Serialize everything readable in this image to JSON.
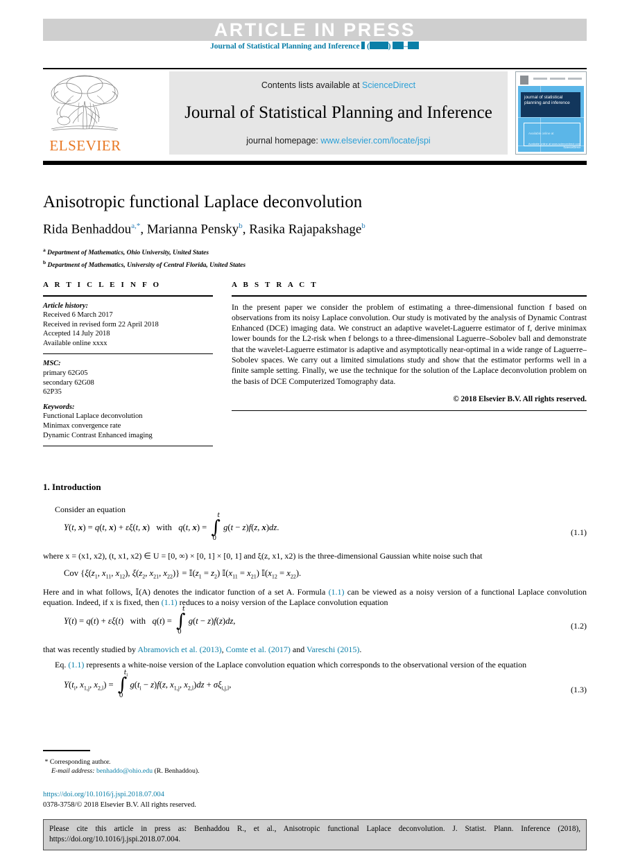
{
  "banner": {
    "label": "ARTICLE  IN  PRESS",
    "running_head_prefix": "Journal of Statistical Planning and Inference"
  },
  "masthead": {
    "contents_prefix": "Contents lists available at",
    "sciencedirect": "ScienceDirect",
    "journal_title": "Journal of Statistical Planning and Inference",
    "homepage_prefix": "journal homepage:",
    "homepage_url": "www.elsevier.com/locate/jspi",
    "publisher": "ELSEVIER",
    "cover": {
      "band_text": "journal of statistical planning and inference",
      "issn_note": "Available online at",
      "footer_line1": "Available online at www.sciencedirect.com",
      "footer_line2": "ScienceDirect"
    }
  },
  "article": {
    "title": "Anisotropic functional Laplace deconvolution",
    "authors": [
      {
        "name": "Rida Benhaddou",
        "marks": "a,*"
      },
      {
        "name": "Marianna Pensky",
        "marks": "b"
      },
      {
        "name": "Rasika Rajapakshage",
        "marks": "b"
      }
    ],
    "authors_plain": "Rida Benhaddou a,*, Marianna Pensky b, Rasika Rajapakshage b",
    "affiliations": [
      {
        "mark": "a",
        "text": "Department of Mathematics, Ohio University, United States"
      },
      {
        "mark": "b",
        "text": "Department of Mathematics, University of Central Florida, United States"
      }
    ]
  },
  "info": {
    "heading": "A R T I C L E   I N F O",
    "history_label": "Article history:",
    "history": [
      "Received 6 March 2017",
      "Received in revised form 22 April 2018",
      "Accepted 14 July 2018",
      "Available online xxxx"
    ],
    "msc_label": "MSC:",
    "msc": [
      "primary 62G05",
      "secondary 62G08",
      "62P35"
    ],
    "keywords_label": "Keywords:",
    "keywords": [
      "Functional Laplace deconvolution",
      "Minimax convergence rate",
      "Dynamic Contrast Enhanced imaging"
    ]
  },
  "abstract": {
    "heading": "A B S T R A C T",
    "text": "In the present paper we consider the problem of estimating a three-dimensional function f based on observations from its noisy Laplace convolution. Our study is motivated by the analysis of Dynamic Contrast Enhanced (DCE) imaging data. We construct an adaptive wavelet-Laguerre estimator of f, derive minimax lower bounds for the L2-risk when f belongs to a three-dimensional Laguerre–Sobolev ball and demonstrate that the wavelet-Laguerre estimator is adaptive and asymptotically near-optimal in a wide range of Laguerre–Sobolev spaces. We carry out a limited simulations study and show that the estimator performs well in a finite sample setting. Finally, we use the technique for the solution of the Laplace deconvolution problem on the basis of DCE Computerized Tomography data.",
    "rights": "© 2018 Elsevier B.V. All rights reserved."
  },
  "body": {
    "section_number": "1.",
    "section_title": "Introduction",
    "p_consider": "Consider an equation",
    "eq11_number": "(1.1)",
    "p_where": "where x = (x1, x2), (t, x1, x2) ∈ U = [0, ∞) × [0, 1] × [0, 1] and ξ(z, x1, x2) is the three-dimensional Gaussian white noise such that",
    "p_here_1": "Here and in what follows, ",
    "p_here_2": "(A) denotes the indicator function of a set A. Formula ",
    "p_here_ref1": "(1.1)",
    "p_here_3": " can be viewed as a noisy version of a functional Laplace convolution equation. Indeed, if x is fixed, then ",
    "p_here_ref2": "(1.1)",
    "p_here_4": " reduces to a noisy version of the Laplace convolution equation",
    "eq12_number": "(1.2)",
    "p_studied_prefix": "that was recently studied by ",
    "refs": [
      {
        "text": "Abramovich et al. (2013)",
        "sep": ", "
      },
      {
        "text": "Comte et al. (2017)",
        "sep": " and "
      },
      {
        "text": "Vareschi (2015)",
        "sep": "."
      }
    ],
    "p_eq_prefix": "Eq. ",
    "p_eq_ref": "(1.1)",
    "p_eq_rest": " represents a white-noise version of the Laplace convolution equation which corresponds to the observational version of the equation",
    "eq13_number": "(1.3)"
  },
  "footnote": {
    "star": "*",
    "corresponding": "Corresponding author.",
    "email_label": "E-mail address:",
    "email": "benhaddo@ohio.edu",
    "email_suffix": "(R. Benhaddou).",
    "doi_url": "https://doi.org/10.1016/j.jspi.2018.07.004",
    "issn_line": "0378-3758/© 2018 Elsevier B.V. All rights reserved."
  },
  "cite_box": {
    "text": "Please cite this article in press as: Benhaddou R., et al., Anisotropic functional Laplace deconvolution. J. Statist. Plann. Inference (2018), https://doi.org/10.1016/j.jspi.2018.07.004."
  },
  "colors": {
    "link_blue": "#0b7fa8",
    "sciencedirect_blue": "#2a9fd6",
    "elsevier_orange": "#e87722",
    "banner_gray": "#cfcfcf",
    "masthead_gray": "#e6e6e6"
  }
}
